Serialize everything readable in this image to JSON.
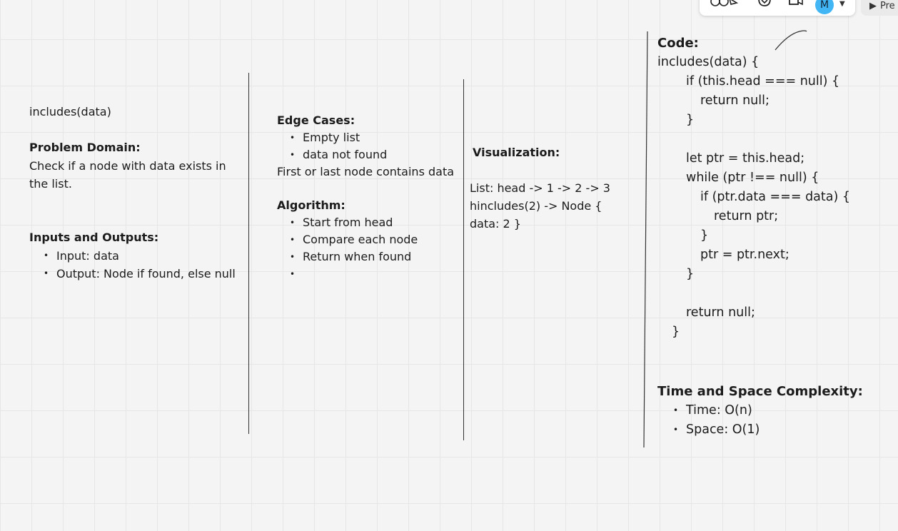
{
  "toolbar": {
    "avatar_initial": "M",
    "present_label": "Pre",
    "icons": [
      "reactions-icon",
      "chat-icon",
      "video-call-icon",
      "chevron-down-icon",
      "play-icon"
    ]
  },
  "col1": {
    "method": "includes(data)",
    "problem_domain_heading": "Problem Domain:",
    "problem_domain_text": "Check if a node with data exists in the list.",
    "io_heading": "Inputs and Outputs:",
    "io_items": [
      "Input: data",
      "Output: Node if found, else null"
    ]
  },
  "col2": {
    "edge_heading": "Edge Cases:",
    "edge_items": [
      "Empty list",
      "data not found"
    ],
    "edge_extra": "First or last node contains data",
    "algo_heading": "Algorithm:",
    "algo_items": [
      "Start from head",
      "Compare each node",
      "Return when found",
      ""
    ]
  },
  "col3": {
    "viz_heading": "Visualization:",
    "viz_text": "List: head -> 1 -> 2 -> 3 hincludes(2) -> Node { data: 2 }"
  },
  "col4": {
    "code_heading": "Code:",
    "code_lines": [
      "includes(data) {",
      "    if (this.head === null) {",
      "      return null;",
      "    }",
      "",
      "    let ptr = this.head;",
      "    while (ptr !== null) {",
      "      if (ptr.data === data) {",
      "        return ptr;",
      "      }",
      "      ptr = ptr.next;",
      "    }",
      "",
      "    return null;",
      "  }"
    ],
    "complexity_heading": "Time and Space Complexity:",
    "complexity_items": [
      "Time: O(n)",
      "Space: O(1)"
    ]
  }
}
